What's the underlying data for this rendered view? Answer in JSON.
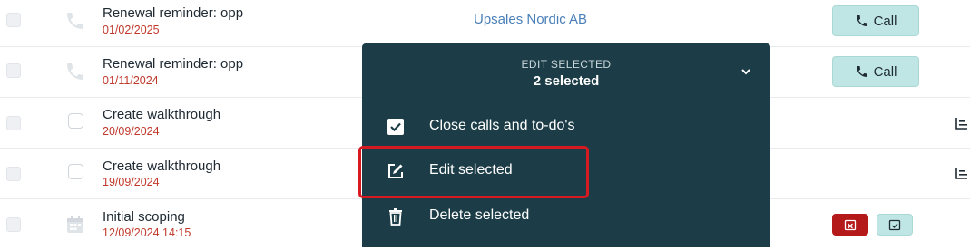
{
  "rows": [
    {
      "title": "Renewal reminder: opp",
      "date": "01/02/2025",
      "type_icon": "phone-icon",
      "company": "Upsales Nordic AB",
      "action": "Call"
    },
    {
      "title": "Renewal reminder: opp",
      "date": "01/11/2024",
      "type_icon": "phone-icon",
      "company": "",
      "action": "Call"
    },
    {
      "title": "Create walkthrough",
      "date": "20/09/2024",
      "type_icon": "todo-checkbox-icon"
    },
    {
      "title": "Create walkthrough",
      "date": "19/09/2024",
      "type_icon": "todo-checkbox-icon"
    },
    {
      "title": "Initial scoping",
      "date": "12/09/2024 14:15",
      "type_icon": "calendar-icon"
    }
  ],
  "menu": {
    "header_label": "EDIT SELECTED",
    "selected_count": "2 selected",
    "items": [
      {
        "label": "Close calls and to-do's",
        "icon": "checkbox-checked-icon"
      },
      {
        "label": "Edit selected",
        "icon": "edit-icon"
      },
      {
        "label": "Delete selected",
        "icon": "trash-icon"
      }
    ]
  },
  "colors": {
    "menu_bg": "#1c3d47",
    "date_red": "#c0392b",
    "link_blue": "#4a7fb8",
    "call_btn": "#bfe6e4",
    "highlight_red": "#d71920"
  }
}
